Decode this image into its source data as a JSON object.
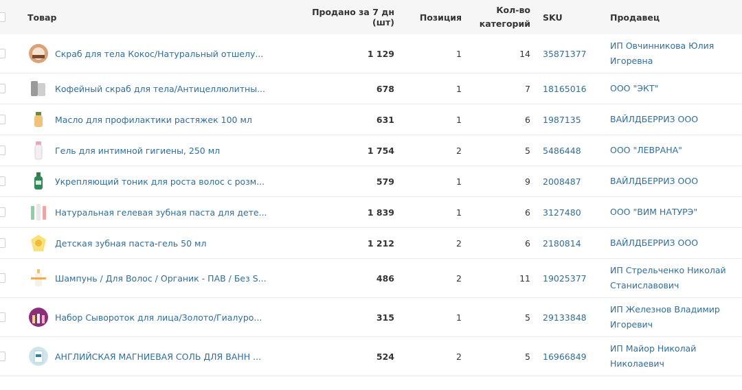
{
  "columns": {
    "product": "Товар",
    "sold7d": "Продано за 7 дн (шт)",
    "position": "Позиция",
    "categories": "Кол-во\nкатегорий",
    "sku": "SKU",
    "seller": "Продавец"
  },
  "rows": [
    {
      "name": "Скраб для тела Кокос/Натуральный отшелу...",
      "sold": "1 129",
      "position": "1",
      "categories": "14",
      "sku": "35871377",
      "seller": "ИП Овчинникова Юлия Игоревна",
      "thumb_icon": "scrub-jar-icon"
    },
    {
      "name": "Кофейный скраб для тела/Антицеллюлитны...",
      "sold": "678",
      "position": "1",
      "categories": "7",
      "sku": "18165016",
      "seller": "ООО \"ЭКТ\"",
      "thumb_icon": "coffee-scrub-pack-icon"
    },
    {
      "name": "Масло для профилактики растяжек 100 мл",
      "sold": "631",
      "position": "1",
      "categories": "6",
      "sku": "1987135",
      "seller": "ВАЙЛДБЕРРИЗ ООО",
      "thumb_icon": "oil-bottle-icon"
    },
    {
      "name": "Гель для интимной гигиены, 250 мл",
      "sold": "1 754",
      "position": "2",
      "categories": "5",
      "sku": "5486448",
      "seller": "ООО \"ЛЕВРАНА\"",
      "thumb_icon": "gel-bottle-icon"
    },
    {
      "name": "Укрепляющий тоник для роста волос с розм...",
      "sold": "579",
      "position": "1",
      "categories": "9",
      "sku": "2008487",
      "seller": "ВАЙЛДБЕРРИЗ ООО",
      "thumb_icon": "tonic-spray-icon"
    },
    {
      "name": "Натуральная гелевая зубная паста для дете...",
      "sold": "1 839",
      "position": "1",
      "categories": "6",
      "sku": "3127480",
      "seller": "ООО \"ВИМ НАТУРЭ\"",
      "thumb_icon": "toothpaste-tubes-icon"
    },
    {
      "name": "Детская зубная паста-гель 50 мл",
      "sold": "1 212",
      "position": "2",
      "categories": "6",
      "sku": "2180814",
      "seller": "ВАЙЛДБЕРРИЗ ООО",
      "thumb_icon": "kids-toothpaste-icon"
    },
    {
      "name": "Шампунь / Для Волос / Органик - ПАВ / Без S...",
      "sold": "486",
      "position": "2",
      "categories": "11",
      "sku": "19025377",
      "seller": "ИП Стрельченко Николай Станиславович",
      "thumb_icon": "shampoo-bottle-icon"
    },
    {
      "name": "Набор Сывороток для лица/Золото/Гиалуро...",
      "sold": "315",
      "position": "1",
      "categories": "5",
      "sku": "29133848",
      "seller": "ИП Железнов Владимир Игоревич",
      "thumb_icon": "serum-set-icon"
    },
    {
      "name": "АНГЛИЙСКАЯ МАГНИЕВАЯ СОЛЬ ДЛЯ ВАНН ...",
      "sold": "524",
      "position": "2",
      "categories": "5",
      "sku": "16966849",
      "seller": "ИП Майор Николай Николаевич",
      "thumb_icon": "bath-salt-icon"
    }
  ]
}
